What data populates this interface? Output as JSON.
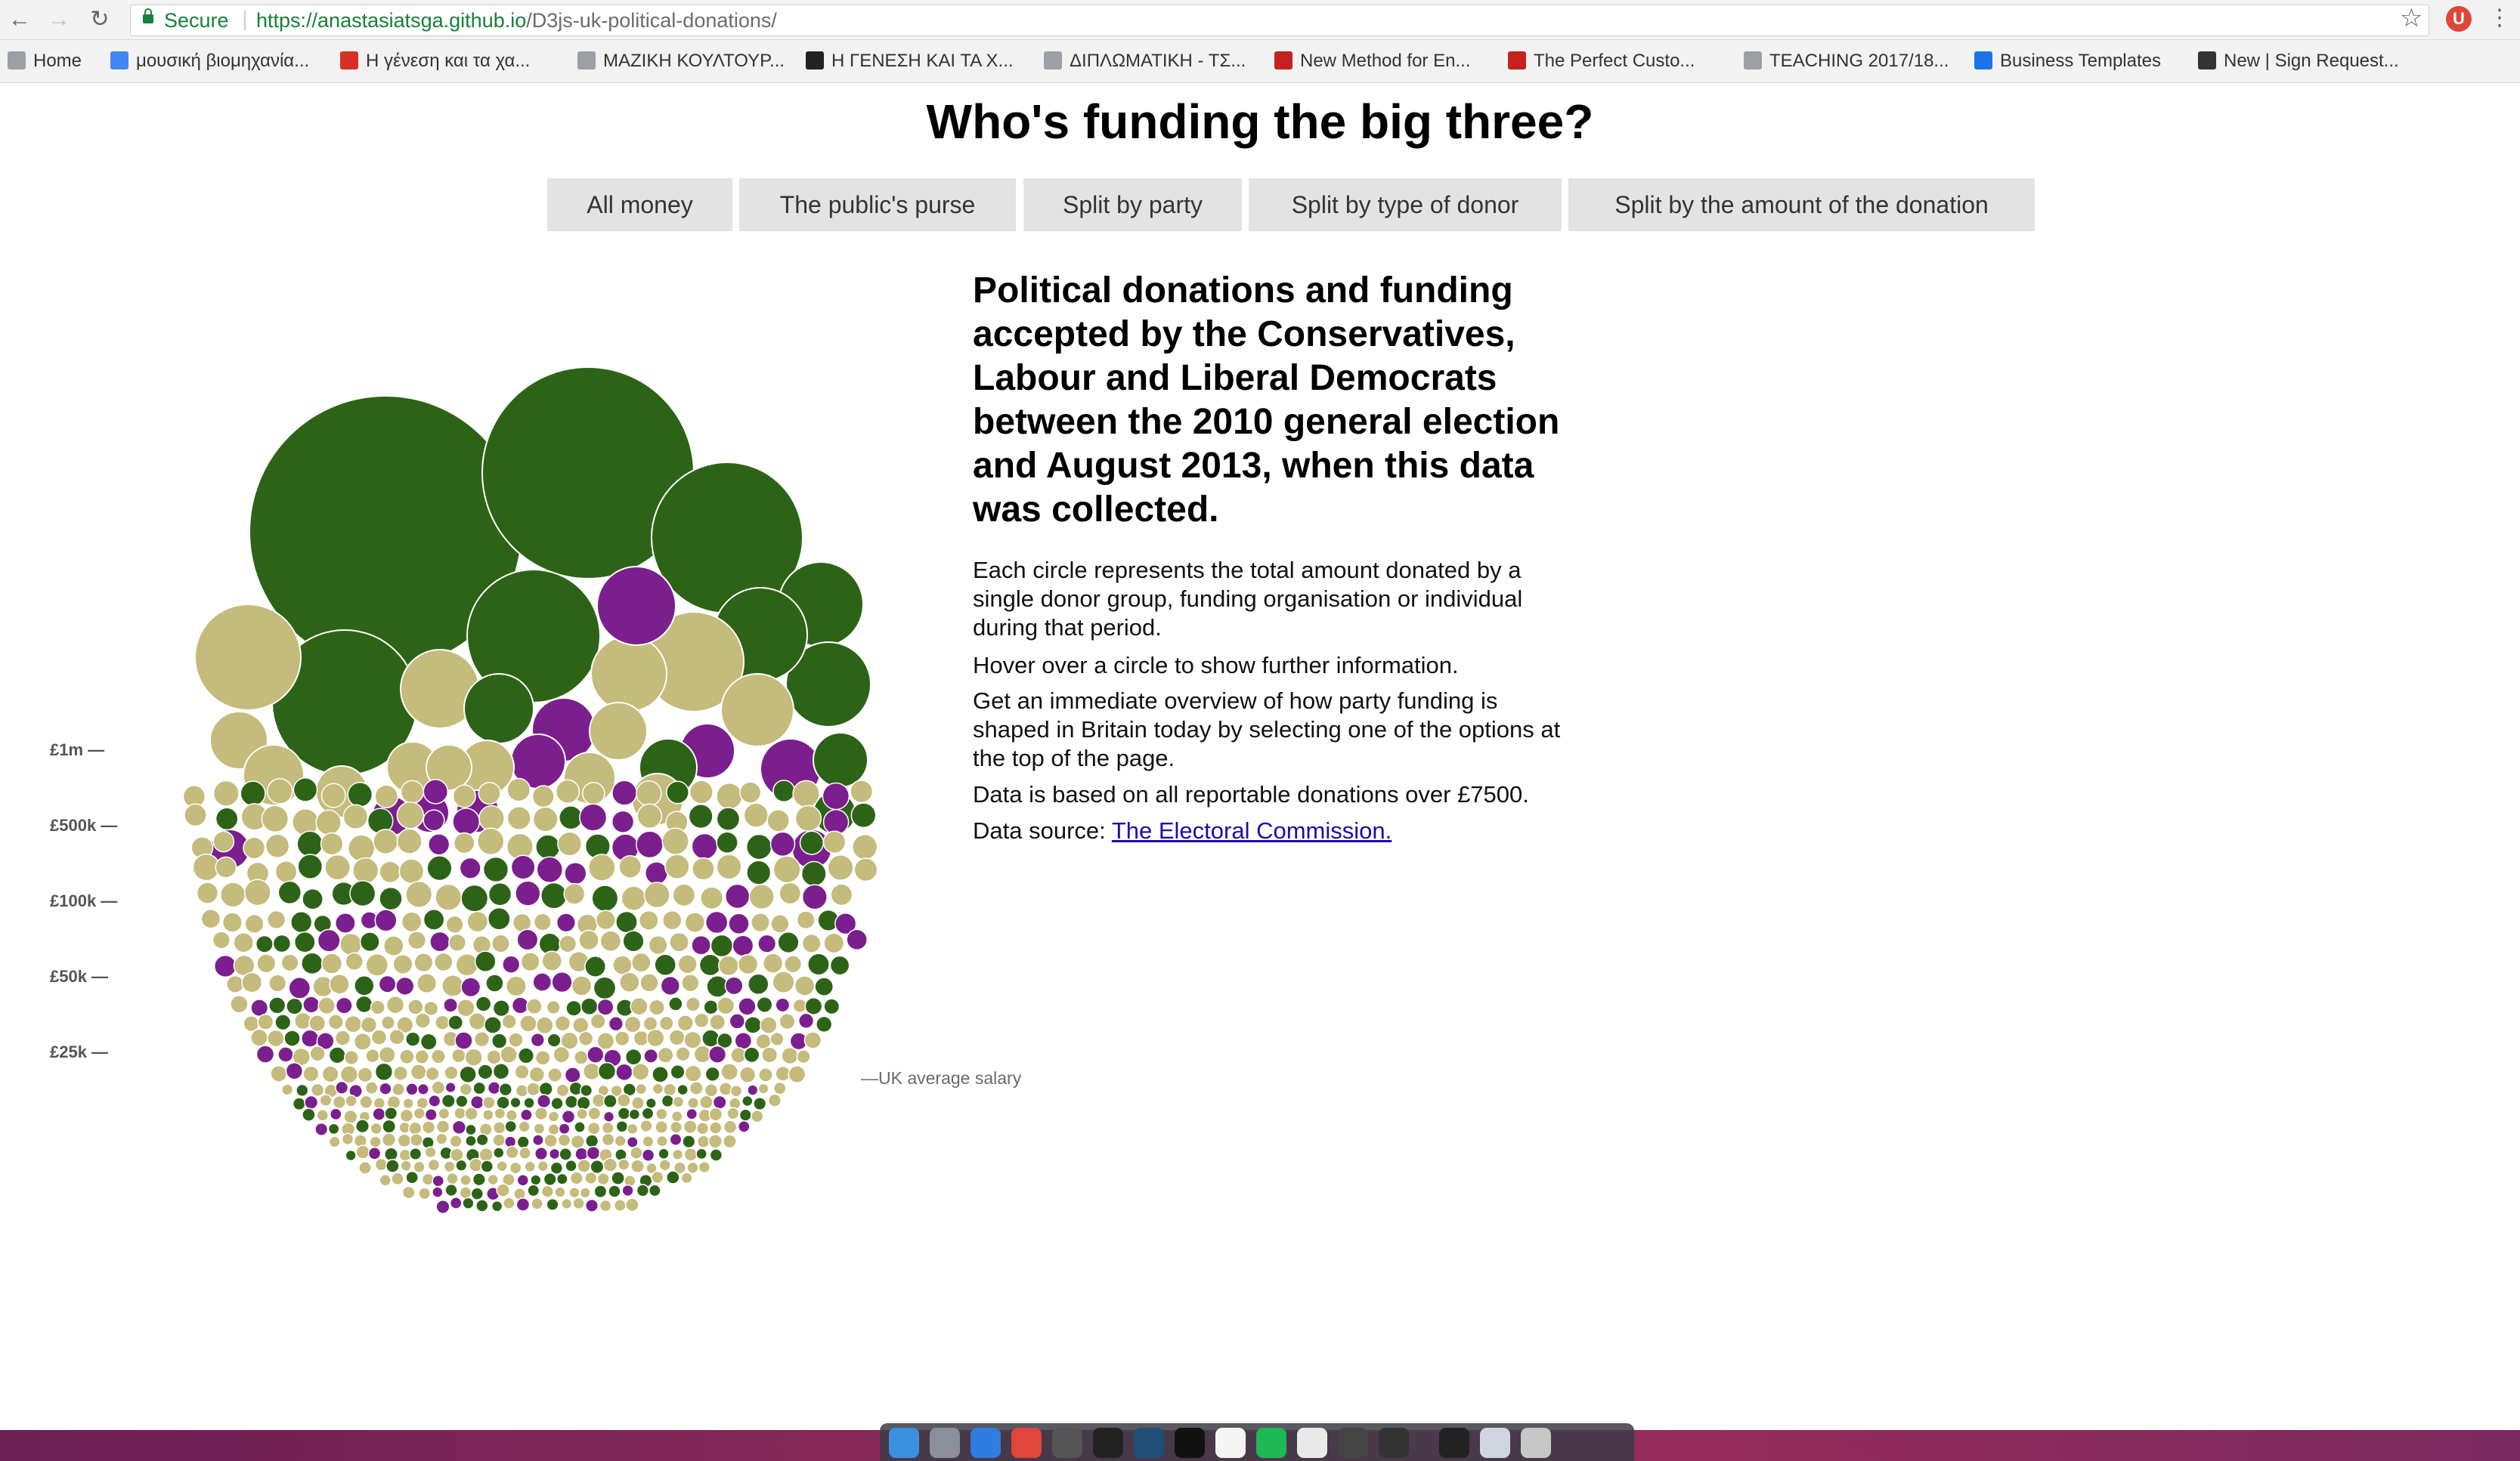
{
  "browser": {
    "secure_label": "Secure",
    "url_host": "https://anastasiatsga.github.io",
    "url_path": "/D3js-uk-political-donations/",
    "bookmarks": [
      {
        "label": "Home",
        "color": "#9aa0a6"
      },
      {
        "label": "μουσική βιομηχανία...",
        "color": "#4285f4"
      },
      {
        "label": "Η γένεση και τα χα...",
        "color": "#d93025"
      },
      {
        "label": "ΜΑΖΙΚΗ ΚΟΥΛΤΟΥΡ...",
        "color": "#9aa0a6"
      },
      {
        "label": "Η ΓΕΝΕΣΗ ΚΑΙ ΤΑ Χ...",
        "color": "#222222"
      },
      {
        "label": "ΔΙΠΛΩΜΑΤΙΚΗ - ΤΣ...",
        "color": "#9aa0a6"
      },
      {
        "label": "New Method for En...",
        "color": "#c5221f"
      },
      {
        "label": "The Perfect Custo...",
        "color": "#c5221f"
      },
      {
        "label": "TEACHING 2017/18...",
        "color": "#9aa0a6"
      },
      {
        "label": "Business Templates",
        "color": "#1a73e8"
      },
      {
        "label": "New | Sign Request...",
        "color": "#333333"
      }
    ]
  },
  "page": {
    "title": "Who's funding the big three?",
    "tabs": [
      "All money",
      "The public's purse",
      "Split by party",
      "Split by type of donor",
      "Split by the amount of the donation"
    ],
    "intro_heading": "Political donations and funding accepted by the Conservatives, Labour and Liberal Democrats between the 2010 general election and August 2013, when this data was collected.",
    "paragraphs": [
      "Each circle represents the total amount donated by a single donor group, funding organisation or individual during that period.",
      "Hover over a circle to show further information.",
      "Get an immediate overview of how party funding is shaped in Britain today by selecting one of the options at the top of the page.",
      "Data is based on all reportable donations over £7500."
    ],
    "source_prefix": "Data source: ",
    "source_link": "The Electoral Commission."
  },
  "chart_data": {
    "type": "scatter",
    "scale_labels": [
      "£1m —",
      "£500k —",
      "£100k —",
      "£50k —",
      "£25k —"
    ],
    "reference_label": "—UK average salary",
    "colors": {
      "conservative": "#c4bb7c",
      "labour": "#2d6317",
      "libdem": "#7b1e8e"
    }
  }
}
